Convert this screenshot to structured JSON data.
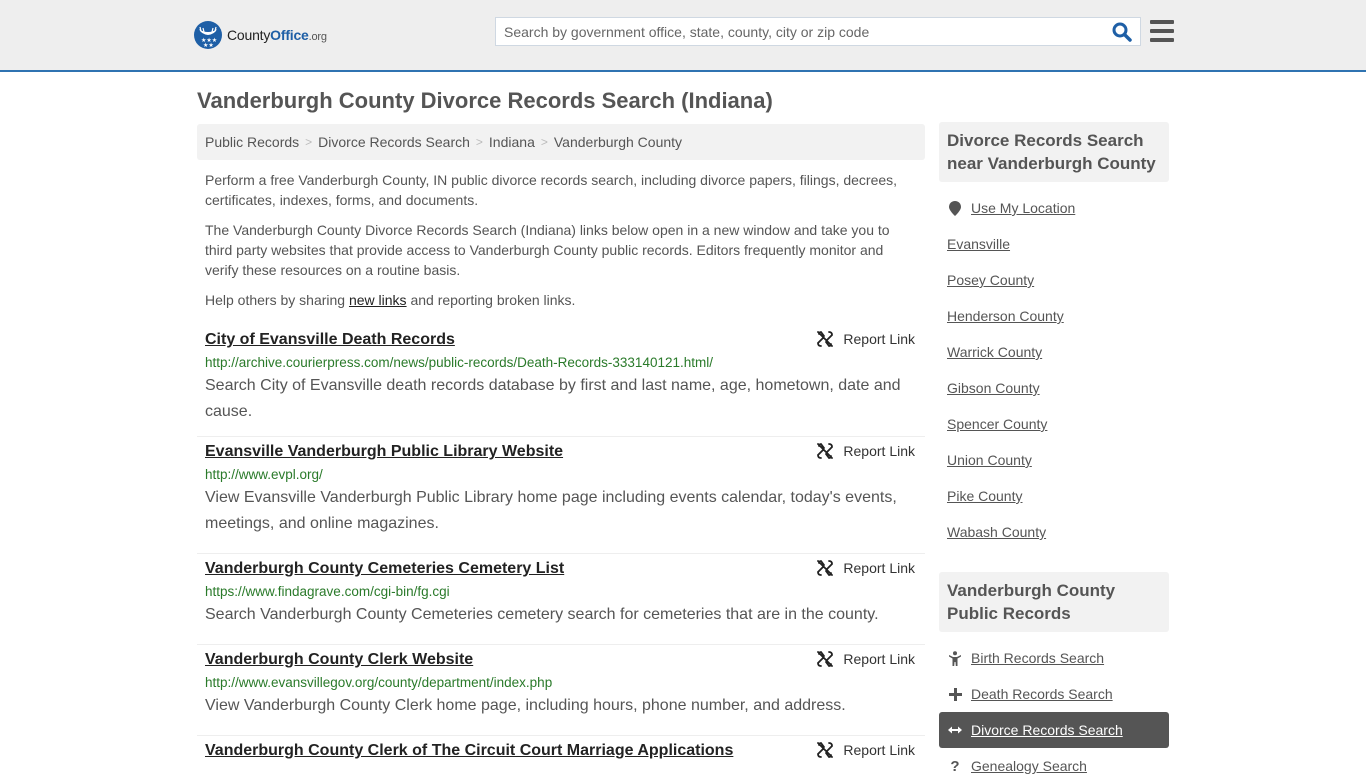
{
  "header": {
    "logo": {
      "name": "County",
      "name_bold": "Office",
      "tld": ".org"
    },
    "search": {
      "placeholder": "Search by government office, state, county, city or zip code",
      "value": ""
    },
    "accent_color": "#2f73b1"
  },
  "page": {
    "title": "Vanderburgh County Divorce Records Search (Indiana)"
  },
  "breadcrumb": [
    {
      "label": "Public Records"
    },
    {
      "label": "Divorce Records Search"
    },
    {
      "label": "Indiana"
    },
    {
      "label": "Vanderburgh County"
    }
  ],
  "intro": {
    "p1": "Perform a free Vanderburgh County, IN public divorce records search, including divorce papers, filings, decrees, certificates, indexes, forms, and documents.",
    "p2": "The Vanderburgh County Divorce Records Search (Indiana) links below open in a new window and take you to third party websites that provide access to Vanderburgh County public records. Editors frequently monitor and verify these resources on a routine basis.",
    "p3_before": "Help others by sharing ",
    "p3_link": "new links",
    "p3_after": " and reporting broken links."
  },
  "report_label": "Report Link",
  "results": [
    {
      "title": "City of Evansville Death Records",
      "url": "http://archive.courierpress.com/news/public-records/Death-Records-333140121.html/",
      "desc": "Search City of Evansville death records database by first and last name, age, hometown, date and cause."
    },
    {
      "title": "Evansville Vanderburgh Public Library Website",
      "url": "http://www.evpl.org/",
      "desc": "View Evansville Vanderburgh Public Library home page including events calendar, today's events, meetings, and online magazines."
    },
    {
      "title": "Vanderburgh County Cemeteries Cemetery List",
      "url": "https://www.findagrave.com/cgi-bin/fg.cgi",
      "desc": "Search Vanderburgh County Cemeteries cemetery search for cemeteries that are in the county."
    },
    {
      "title": "Vanderburgh County Clerk Website",
      "url": "http://www.evansvillegov.org/county/department/index.php",
      "desc": "View Vanderburgh County Clerk home page, including hours, phone number, and address."
    },
    {
      "title": "Vanderburgh County Clerk of The Circuit Court Marriage Applications",
      "url": "",
      "desc": ""
    }
  ],
  "sidebar": {
    "nearby": {
      "heading": "Divorce Records Search near Vanderburgh County",
      "use_location": "Use My Location",
      "items": [
        "Evansville",
        "Posey County",
        "Henderson County",
        "Warrick County",
        "Gibson County",
        "Spencer County",
        "Union County",
        "Pike County",
        "Wabash County"
      ]
    },
    "public_records": {
      "heading": "Vanderburgh County Public Records",
      "items": [
        {
          "label": "Birth Records Search",
          "icon": "child-icon",
          "active": false
        },
        {
          "label": "Death Records Search",
          "icon": "plus-icon",
          "active": false
        },
        {
          "label": "Divorce Records Search",
          "icon": "arrows-horizontal-icon",
          "active": true
        },
        {
          "label": "Genealogy Search",
          "icon": "question-icon",
          "active": false
        }
      ]
    }
  }
}
